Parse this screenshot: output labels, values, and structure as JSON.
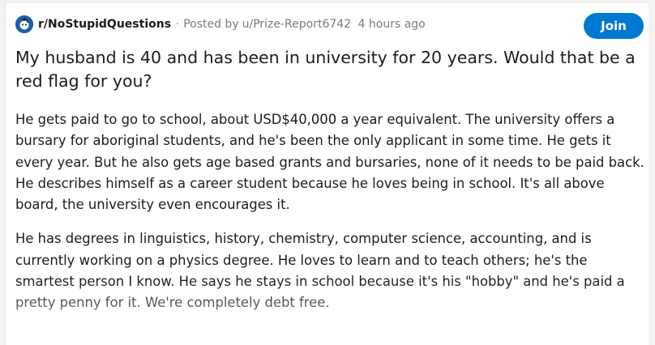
{
  "post": {
    "subreddit": "r/NoStupidQuestions",
    "separator": "·",
    "posted_by_prefix": "Posted by",
    "author": "u/Prize-Report6742",
    "time_ago": "4 hours ago",
    "join_label": "Join",
    "title": "My husband is 40 and has been in university for 20 years. Would that be a red flag for you?",
    "paragraphs": [
      "He gets paid to go to school, about USD$40,000 a year equivalent. The university offers a bursary for aboriginal students, and he's been the only applicant in some time. He gets it every year. But he also gets age based grants and bursaries, none of it needs to be paid back. He describes himself as a career student because he loves being in school. It's all above board, the university even encourages it.",
      "He has degrees in linguistics, history, chemistry, computer science, accounting, and is currently working on a physics degree. He loves to learn and to teach others; he's the smartest person I know. He says he stays in school because it's his \"hobby\" and he's paid a pretty penny for it. We're completely debt free."
    ]
  },
  "colors": {
    "accent": "#0079d3",
    "subreddit_icon_bg": "#1f5fa8",
    "text": "#1c1c1c",
    "meta_text": "#787c7e"
  },
  "icons": {
    "subreddit": "nostupidquestions-icon"
  }
}
